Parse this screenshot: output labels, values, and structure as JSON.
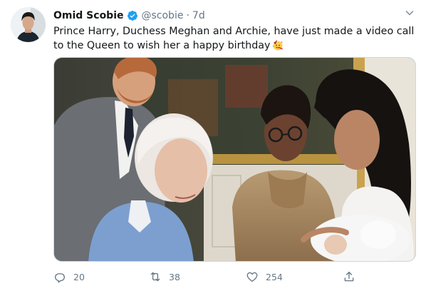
{
  "user": {
    "name": "Omid Scobie",
    "handle": "@scobie",
    "separator": "·",
    "time": "7d"
  },
  "tweet": {
    "text": "Prince Harry, Duchess Meghan and Archie, have just made a video call to the Queen to wish her a happy birthday",
    "emoji": "party-face-emoji"
  },
  "actions": {
    "reply_count": "20",
    "retweet_count": "38",
    "like_count": "254"
  },
  "icons": {
    "verified": "verified-badge-icon",
    "caret": "chevron-down-icon",
    "reply": "reply-icon",
    "retweet": "retweet-icon",
    "like": "heart-icon",
    "share": "share-icon"
  },
  "colors": {
    "verified_blue": "#1da1f2",
    "secondary_text": "#657786",
    "primary_text": "#14171a"
  }
}
